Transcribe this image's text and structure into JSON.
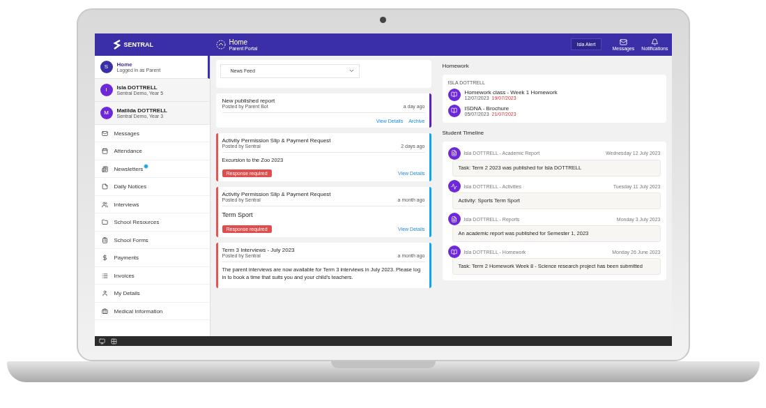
{
  "top_bar": {
    "logo": "SENTRAL",
    "page_title": "Home",
    "page_subtitle": "Parent Portal",
    "account_button": "Isla Alert",
    "actions": [
      {
        "label": "Messages"
      },
      {
        "label": "Notifications"
      }
    ]
  },
  "sidebar": {
    "profiles": [
      {
        "name": "Home",
        "subtitle": "Logged in as Parent",
        "initial": "S",
        "selected": true
      },
      {
        "name": "Isla DOTTRELL",
        "subtitle": "Sentral Demo, Year 5",
        "initial": "I",
        "selected": false
      },
      {
        "name": "Matilda DOTTRELL",
        "subtitle": "Sentral Demo, Year 3",
        "initial": "M",
        "selected": false
      }
    ],
    "items": [
      {
        "label": "Messages",
        "badge": false
      },
      {
        "label": "Attendance",
        "badge": false
      },
      {
        "label": "Newsletters",
        "badge": true
      },
      {
        "label": "Daily Notices",
        "badge": false
      },
      {
        "label": "Interviews",
        "badge": false
      },
      {
        "label": "School Resources",
        "badge": false
      },
      {
        "label": "School Forms",
        "badge": false
      },
      {
        "label": "Payments",
        "badge": false
      },
      {
        "label": "Invoices",
        "badge": false
      },
      {
        "label": "My Details",
        "badge": false
      },
      {
        "label": "Medical Information",
        "badge": false
      }
    ]
  },
  "feed": {
    "filter": "News Feed",
    "cards": [
      {
        "kind": "report",
        "title": "New published report",
        "posted_by": "Posted by Parent Bot",
        "time": "a day ago",
        "color": "#5b21b6",
        "flagged": false,
        "links": [
          "View Details",
          "Archive"
        ]
      },
      {
        "kind": "permission",
        "title": "Activity Permission Slip & Payment Request",
        "posted_by": "Posted by Sentral",
        "time": "2 days ago",
        "color": "#0ea5e9",
        "flagged": true,
        "body": "Excursion to the Zoo 2023",
        "status": "Response required",
        "link": "View Details"
      },
      {
        "kind": "permission",
        "title": "Activity Permission Slip & Payment Request",
        "posted_by": "Posted by Sentral",
        "time": "a month ago",
        "color": "#0ea5e9",
        "flagged": true,
        "body": "Term Sport",
        "status": "Response required",
        "link": "View Details"
      },
      {
        "kind": "notice",
        "title": "Term 3 Interviews - July 2023",
        "posted_by": "Posted by Sentral",
        "time": "a month ago",
        "color": "#0ea5e9",
        "flagged": true,
        "body": "The parent interviews are now available for Term 3 interviews in July 2023. Please log in to book a time that suits you and your child's teachers."
      }
    ]
  },
  "homework": {
    "title": "Homework",
    "student": "ISLA DOTTRELL",
    "items": [
      {
        "title": "Homework class - Week 1 Homework",
        "assigned": "12/07/2023",
        "due": "19/07/2023"
      },
      {
        "title": "ISDNA - Brochure",
        "assigned": "05/07/2023",
        "due": "21/07/2023"
      }
    ]
  },
  "timeline": {
    "title": "Student Timeline",
    "entries": [
      {
        "author": "Isla DOTTRELL - Academic Report",
        "time": "Wednesday 12 July 2023",
        "text": "Task: Term 2 2023 was published for Isla DOTTRELL"
      },
      {
        "author": "Isla DOTTRELL - Activities",
        "time": "Tuesday 11 July 2023",
        "text": "Activity: Sports Term Sport"
      },
      {
        "author": "Isla DOTTRELL - Reports",
        "time": "Monday 3 July 2023",
        "text": "An academic report was published for Semester 1, 2023"
      },
      {
        "author": "Isla DOTTRELL - Homework",
        "time": "Monday 26 June 2023",
        "text": "Task: Term 2 Homework Week 8 - Science research project has been submitted"
      }
    ]
  }
}
